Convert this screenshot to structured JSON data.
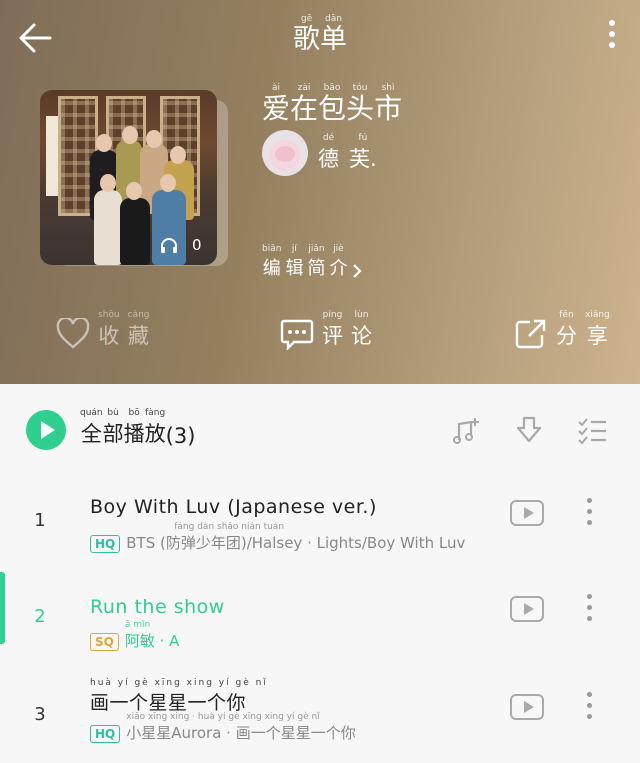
{
  "header": {
    "title": "歌单",
    "title_pinyin": [
      "gē",
      "dān"
    ],
    "playlist_name": "爱在包头市",
    "playlist_name_pinyin": [
      "ài",
      "zài",
      "bāo",
      "tóu",
      "shì"
    ],
    "creator": "德芙.",
    "creator_pinyin": [
      "dé",
      "fú"
    ],
    "edit_intro": "编辑简介",
    "edit_intro_pinyin": [
      "biān",
      "jí",
      "jiǎn",
      "jiè"
    ],
    "play_count": "0"
  },
  "actions": {
    "favorite": {
      "label": "收藏",
      "pinyin": [
        "shōu",
        "cáng"
      ],
      "icon": "heart-icon"
    },
    "comment": {
      "label": "评论",
      "pinyin": [
        "píng",
        "lùn"
      ],
      "icon": "comment-icon"
    },
    "share": {
      "label": "分享",
      "pinyin": [
        "fēn",
        "xiǎng"
      ],
      "icon": "share-icon"
    }
  },
  "list": {
    "play_all": "全部播放",
    "play_all_pinyin": [
      "quán",
      "bù",
      "bō",
      "fàng"
    ],
    "count": "(3)",
    "songs": [
      {
        "index": "1",
        "name": "Boy With Luv (Japanese ver.)",
        "quality": "HQ",
        "artist": "BTS (防弹少年团)/Halsey · Lights/Boy With Luv",
        "artist_pinyin": "fáng dàn shǎo nián tuán"
      },
      {
        "index": "2",
        "name": "Run the show",
        "quality": "SQ",
        "artist": "阿敏 · A",
        "artist_pinyin": "ā mǐn"
      },
      {
        "index": "3",
        "name": "画一个星星一个你",
        "name_pinyin": "huà yí gè xīng xing yí gè nǐ",
        "quality": "HQ",
        "artist": "小星星Aurora · 画一个星星一个你",
        "artist_pinyin": "xiǎo xīng xing · huà yí gè xīng xing yí gè nǐ"
      }
    ]
  },
  "colors": {
    "accent": "#2fcf8f",
    "hq": "#2fbfa0",
    "sq": "#e0a53a"
  }
}
